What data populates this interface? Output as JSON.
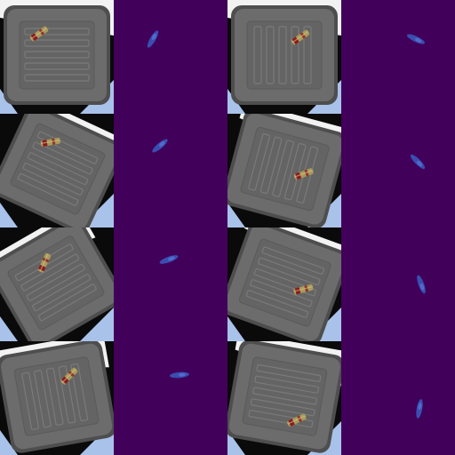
{
  "grid": {
    "rows": 4,
    "columns": 4
  },
  "colors": {
    "mask_background": "#41005a",
    "mask_blob": "#3a56b8",
    "tray": "#6c6c6c",
    "tray_rim": "#4e4e4e",
    "tray_floor": "#646464",
    "ridge": "#7a7a7a",
    "object_body": "#a89a5a",
    "object_mark": "#8a1a22",
    "backdrop_light": "#f2f2f2",
    "backdrop_blue": "#a9c2ea",
    "backdrop_dark": "#0a0a0a"
  },
  "panels": [
    {
      "id": "A1",
      "type": "photo",
      "rotation": 0,
      "ridge_dir": "horizontal",
      "object": {
        "pos": "top-left"
      }
    },
    {
      "id": "A2",
      "type": "mask",
      "blob_angle": -60
    },
    {
      "id": "A3",
      "type": "photo",
      "rotation": 0,
      "ridge_dir": "vertical",
      "object": {
        "pos": "top-right"
      }
    },
    {
      "id": "A4",
      "type": "mask",
      "blob_angle": 25
    },
    {
      "id": "B1",
      "type": "photo",
      "rotation": 25,
      "ridge_dir": "horizontal",
      "object": {
        "pos": "top-left"
      }
    },
    {
      "id": "B2",
      "type": "mask",
      "blob_angle": -40
    },
    {
      "id": "B3",
      "type": "photo",
      "rotation": 15,
      "ridge_dir": "vertical",
      "object": {
        "pos": "center-right"
      }
    },
    {
      "id": "B4",
      "type": "mask",
      "blob_angle": 45
    },
    {
      "id": "C1",
      "type": "photo",
      "rotation": -30,
      "ridge_dir": "horizontal",
      "object": {
        "pos": "top-center"
      }
    },
    {
      "id": "C2",
      "type": "mask",
      "blob_angle": -20
    },
    {
      "id": "C3",
      "type": "photo",
      "rotation": 20,
      "ridge_dir": "horizontal",
      "object": {
        "pos": "center-right"
      }
    },
    {
      "id": "C4",
      "type": "mask",
      "blob_angle": 70
    },
    {
      "id": "D1",
      "type": "photo",
      "rotation": -10,
      "ridge_dir": "vertical",
      "object": {
        "pos": "top-right"
      }
    },
    {
      "id": "D2",
      "type": "mask",
      "blob_angle": -5
    },
    {
      "id": "D3",
      "type": "photo",
      "rotation": 10,
      "ridge_dir": "horizontal",
      "object": {
        "pos": "bottom-right"
      }
    },
    {
      "id": "D4",
      "type": "mask",
      "blob_angle": -80
    }
  ]
}
